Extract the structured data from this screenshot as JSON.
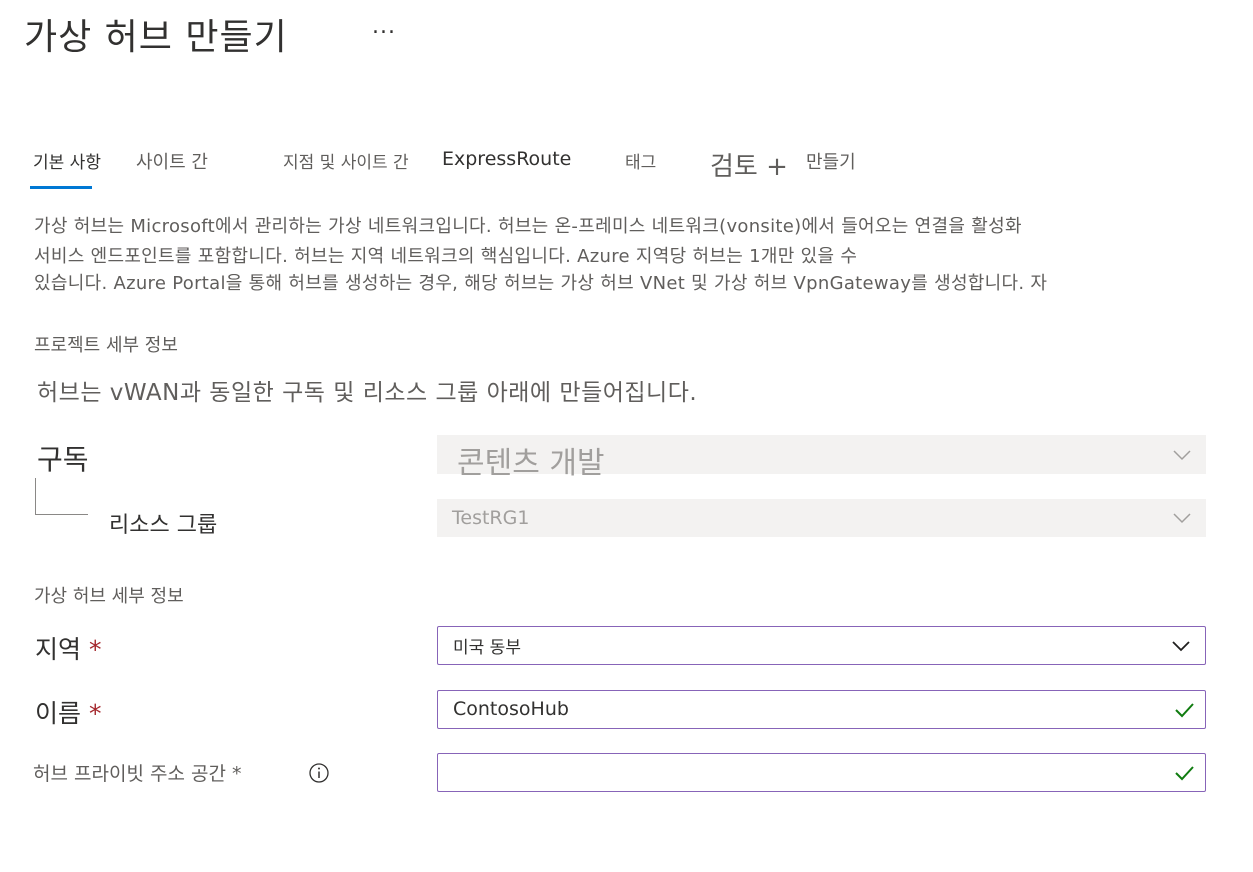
{
  "header": {
    "title": "가상 허브 만들기",
    "more_label": "..."
  },
  "tabs": [
    {
      "label": "기본 사항",
      "selected": true
    },
    {
      "label": "사이트 간"
    },
    {
      "label": "지점 및 사이트 간"
    },
    {
      "label": "ExpressRoute"
    },
    {
      "label": "태그"
    },
    {
      "label": "검토 +"
    },
    {
      "label": "만들기"
    }
  ],
  "description": {
    "line1": "가상 허브는 Microsoft에서 관리하는 가상 네트워크입니다. 허브는 온-프레미스 네트워크(vonsite)에서 들어오는 연결을 활성화",
    "line2": "서비스 엔드포인트를 포함합니다. 허브는 지역 네트워크의 핵심입니다. Azure 지역당 허브는 1개만 있을 수",
    "line3": "있습니다. Azure Portal을 통해 허브를 생성하는 경우, 해당 허브는 가상 허브 VNet 및 가상 허브 VpnGateway를 생성합니다. 자"
  },
  "project": {
    "header": "프로젝트 세부 정보",
    "info": "허브는 vWAN과 동일한 구독 및 리소스 그룹 아래에 만들어집니다.",
    "subscription_label": "구독",
    "subscription_value": "콘텐츠 개발",
    "resource_group_label": "리소스 그룹",
    "resource_group_value": "TestRG1"
  },
  "hub_details": {
    "header": "가상 허브 세부 정보",
    "region_label": "지역",
    "region_value": "미국 동부",
    "name_label": "이름",
    "name_value": "ContosoHub",
    "address_label": "허브 프라이빗 주소 공간",
    "address_value": "",
    "required_mark": "*"
  },
  "icons": {
    "chevron": "chevron-down-icon",
    "check": "checkmark-icon",
    "info": "info-icon"
  },
  "colors": {
    "accent": "#0078d4",
    "focus_border": "#8764b8",
    "required": "#a4262c",
    "valid": "#107c10"
  }
}
